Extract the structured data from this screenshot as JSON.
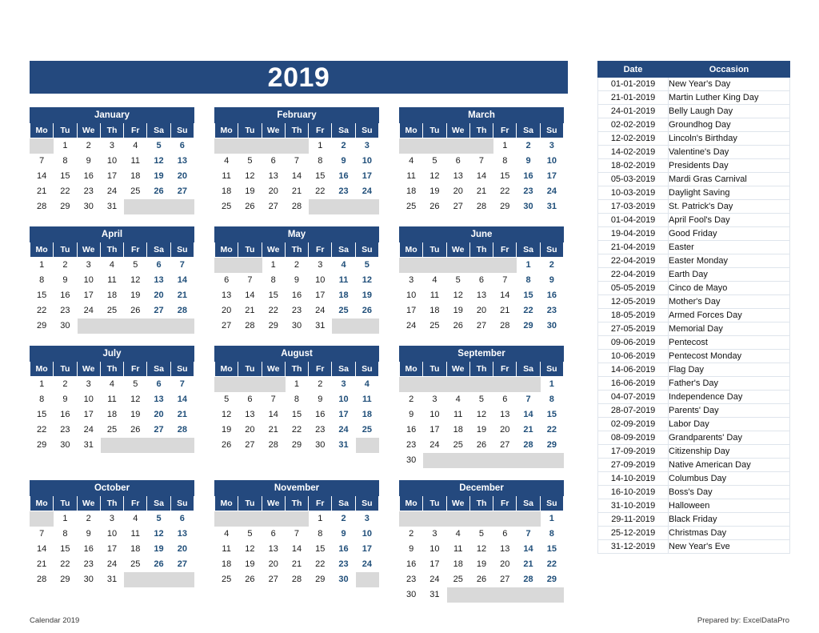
{
  "document": {
    "title": "2019",
    "footer_left": "Calendar 2019",
    "footer_right": "Prepared by: ExcelDataPro"
  },
  "colors": {
    "header_blue": "#24497e",
    "weekend_text": "#1f4e79",
    "empty_cell": "#d9d9d9",
    "grid_line": "#e3e8ef"
  },
  "weekday_headers": [
    "Mo",
    "Tu",
    "We",
    "Th",
    "Fr",
    "Sa",
    "Su"
  ],
  "months": [
    {
      "name": "January",
      "lead_blanks": 1,
      "days": 31,
      "weeks": [
        [
          "",
          "1",
          "2",
          "3",
          "4",
          "5",
          "6"
        ],
        [
          "7",
          "8",
          "9",
          "10",
          "11",
          "12",
          "13"
        ],
        [
          "14",
          "15",
          "16",
          "17",
          "18",
          "19",
          "20"
        ],
        [
          "21",
          "22",
          "23",
          "24",
          "25",
          "26",
          "27"
        ],
        [
          "28",
          "29",
          "30",
          "31",
          "",
          "",
          ""
        ]
      ]
    },
    {
      "name": "February",
      "lead_blanks": 4,
      "days": 28,
      "weeks": [
        [
          "",
          "",
          "",
          "",
          "1",
          "2",
          "3"
        ],
        [
          "4",
          "5",
          "6",
          "7",
          "8",
          "9",
          "10"
        ],
        [
          "11",
          "12",
          "13",
          "14",
          "15",
          "16",
          "17"
        ],
        [
          "18",
          "19",
          "20",
          "21",
          "22",
          "23",
          "24"
        ],
        [
          "25",
          "26",
          "27",
          "28",
          "",
          "",
          ""
        ]
      ]
    },
    {
      "name": "March",
      "lead_blanks": 4,
      "days": 31,
      "weeks": [
        [
          "",
          "",
          "",
          "",
          "1",
          "2",
          "3"
        ],
        [
          "4",
          "5",
          "6",
          "7",
          "8",
          "9",
          "10"
        ],
        [
          "11",
          "12",
          "13",
          "14",
          "15",
          "16",
          "17"
        ],
        [
          "18",
          "19",
          "20",
          "21",
          "22",
          "23",
          "24"
        ],
        [
          "25",
          "26",
          "27",
          "28",
          "29",
          "30",
          "31"
        ]
      ]
    },
    {
      "name": "April",
      "lead_blanks": 0,
      "days": 30,
      "weeks": [
        [
          "1",
          "2",
          "3",
          "4",
          "5",
          "6",
          "7"
        ],
        [
          "8",
          "9",
          "10",
          "11",
          "12",
          "13",
          "14"
        ],
        [
          "15",
          "16",
          "17",
          "18",
          "19",
          "20",
          "21"
        ],
        [
          "22",
          "23",
          "24",
          "25",
          "26",
          "27",
          "28"
        ],
        [
          "29",
          "30",
          "",
          "",
          "",
          "",
          ""
        ]
      ]
    },
    {
      "name": "May",
      "lead_blanks": 2,
      "days": 31,
      "weeks": [
        [
          "",
          "",
          "1",
          "2",
          "3",
          "4",
          "5"
        ],
        [
          "6",
          "7",
          "8",
          "9",
          "10",
          "11",
          "12"
        ],
        [
          "13",
          "14",
          "15",
          "16",
          "17",
          "18",
          "19"
        ],
        [
          "20",
          "21",
          "22",
          "23",
          "24",
          "25",
          "26"
        ],
        [
          "27",
          "28",
          "29",
          "30",
          "31",
          "",
          ""
        ]
      ]
    },
    {
      "name": "June",
      "lead_blanks": 5,
      "days": 30,
      "weeks": [
        [
          "",
          "",
          "",
          "",
          "",
          "1",
          "2"
        ],
        [
          "3",
          "4",
          "5",
          "6",
          "7",
          "8",
          "9"
        ],
        [
          "10",
          "11",
          "12",
          "13",
          "14",
          "15",
          "16"
        ],
        [
          "17",
          "18",
          "19",
          "20",
          "21",
          "22",
          "23"
        ],
        [
          "24",
          "25",
          "26",
          "27",
          "28",
          "29",
          "30"
        ]
      ]
    },
    {
      "name": "July",
      "lead_blanks": 0,
      "days": 31,
      "weeks": [
        [
          "1",
          "2",
          "3",
          "4",
          "5",
          "6",
          "7"
        ],
        [
          "8",
          "9",
          "10",
          "11",
          "12",
          "13",
          "14"
        ],
        [
          "15",
          "16",
          "17",
          "18",
          "19",
          "20",
          "21"
        ],
        [
          "22",
          "23",
          "24",
          "25",
          "26",
          "27",
          "28"
        ],
        [
          "29",
          "30",
          "31",
          "",
          "",
          "",
          ""
        ]
      ]
    },
    {
      "name": "August",
      "lead_blanks": 3,
      "days": 31,
      "weeks": [
        [
          "",
          "",
          "",
          "1",
          "2",
          "3",
          "4"
        ],
        [
          "5",
          "6",
          "7",
          "8",
          "9",
          "10",
          "11"
        ],
        [
          "12",
          "13",
          "14",
          "15",
          "16",
          "17",
          "18"
        ],
        [
          "19",
          "20",
          "21",
          "22",
          "23",
          "24",
          "25"
        ],
        [
          "26",
          "27",
          "28",
          "29",
          "30",
          "31",
          ""
        ]
      ]
    },
    {
      "name": "September",
      "lead_blanks": 6,
      "days": 30,
      "weeks": [
        [
          "",
          "",
          "",
          "",
          "",
          "",
          "1"
        ],
        [
          "2",
          "3",
          "4",
          "5",
          "6",
          "7",
          "8"
        ],
        [
          "9",
          "10",
          "11",
          "12",
          "13",
          "14",
          "15"
        ],
        [
          "16",
          "17",
          "18",
          "19",
          "20",
          "21",
          "22"
        ],
        [
          "23",
          "24",
          "25",
          "26",
          "27",
          "28",
          "29"
        ],
        [
          "30",
          "",
          "",
          "",
          "",
          "",
          ""
        ]
      ]
    },
    {
      "name": "October",
      "lead_blanks": 1,
      "days": 31,
      "weeks": [
        [
          "",
          "1",
          "2",
          "3",
          "4",
          "5",
          "6"
        ],
        [
          "7",
          "8",
          "9",
          "10",
          "11",
          "12",
          "13"
        ],
        [
          "14",
          "15",
          "16",
          "17",
          "18",
          "19",
          "20"
        ],
        [
          "21",
          "22",
          "23",
          "24",
          "25",
          "26",
          "27"
        ],
        [
          "28",
          "29",
          "30",
          "31",
          "",
          "",
          ""
        ]
      ]
    },
    {
      "name": "November",
      "lead_blanks": 4,
      "days": 30,
      "weeks": [
        [
          "",
          "",
          "",
          "",
          "1",
          "2",
          "3"
        ],
        [
          "4",
          "5",
          "6",
          "7",
          "8",
          "9",
          "10"
        ],
        [
          "11",
          "12",
          "13",
          "14",
          "15",
          "16",
          "17"
        ],
        [
          "18",
          "19",
          "20",
          "21",
          "22",
          "23",
          "24"
        ],
        [
          "25",
          "26",
          "27",
          "28",
          "29",
          "30",
          ""
        ]
      ]
    },
    {
      "name": "December",
      "lead_blanks": 6,
      "days": 31,
      "weeks": [
        [
          "",
          "",
          "",
          "",
          "",
          "",
          "1"
        ],
        [
          "2",
          "3",
          "4",
          "5",
          "6",
          "7",
          "8"
        ],
        [
          "9",
          "10",
          "11",
          "12",
          "13",
          "14",
          "15"
        ],
        [
          "16",
          "17",
          "18",
          "19",
          "20",
          "21",
          "22"
        ],
        [
          "23",
          "24",
          "25",
          "26",
          "27",
          "28",
          "29"
        ],
        [
          "30",
          "31",
          "",
          "",
          "",
          "",
          ""
        ]
      ]
    }
  ],
  "holiday_table": {
    "headers": [
      "Date",
      "Occasion"
    ],
    "rows": [
      [
        "01-01-2019",
        "New Year's Day"
      ],
      [
        "21-01-2019",
        "Martin Luther King Day"
      ],
      [
        "24-01-2019",
        "Belly Laugh Day"
      ],
      [
        "02-02-2019",
        "Groundhog Day"
      ],
      [
        "12-02-2019",
        "Lincoln's Birthday"
      ],
      [
        "14-02-2019",
        "Valentine's Day"
      ],
      [
        "18-02-2019",
        "Presidents Day"
      ],
      [
        "05-03-2019",
        "Mardi Gras Carnival"
      ],
      [
        "10-03-2019",
        "Daylight Saving"
      ],
      [
        "17-03-2019",
        "St. Patrick's Day"
      ],
      [
        "01-04-2019",
        "April Fool's Day"
      ],
      [
        "19-04-2019",
        "Good Friday"
      ],
      [
        "21-04-2019",
        "Easter"
      ],
      [
        "22-04-2019",
        "Easter Monday"
      ],
      [
        "22-04-2019",
        "Earth Day"
      ],
      [
        "05-05-2019",
        "Cinco de Mayo"
      ],
      [
        "12-05-2019",
        "Mother's Day"
      ],
      [
        "18-05-2019",
        "Armed Forces Day"
      ],
      [
        "27-05-2019",
        "Memorial Day"
      ],
      [
        "09-06-2019",
        "Pentecost"
      ],
      [
        "10-06-2019",
        "Pentecost Monday"
      ],
      [
        "14-06-2019",
        "Flag Day"
      ],
      [
        "16-06-2019",
        "Father's Day"
      ],
      [
        "04-07-2019",
        "Independence Day"
      ],
      [
        "28-07-2019",
        "Parents' Day"
      ],
      [
        "02-09-2019",
        "Labor Day"
      ],
      [
        "08-09-2019",
        "Grandparents' Day"
      ],
      [
        "17-09-2019",
        "Citizenship Day"
      ],
      [
        "27-09-2019",
        "Native American Day"
      ],
      [
        "14-10-2019",
        "Columbus Day"
      ],
      [
        "16-10-2019",
        "Boss's Day"
      ],
      [
        "31-10-2019",
        "Halloween"
      ],
      [
        "29-11-2019",
        "Black Friday"
      ],
      [
        "25-12-2019",
        "Christmas Day"
      ],
      [
        "31-12-2019",
        "New Year's Eve"
      ]
    ]
  }
}
